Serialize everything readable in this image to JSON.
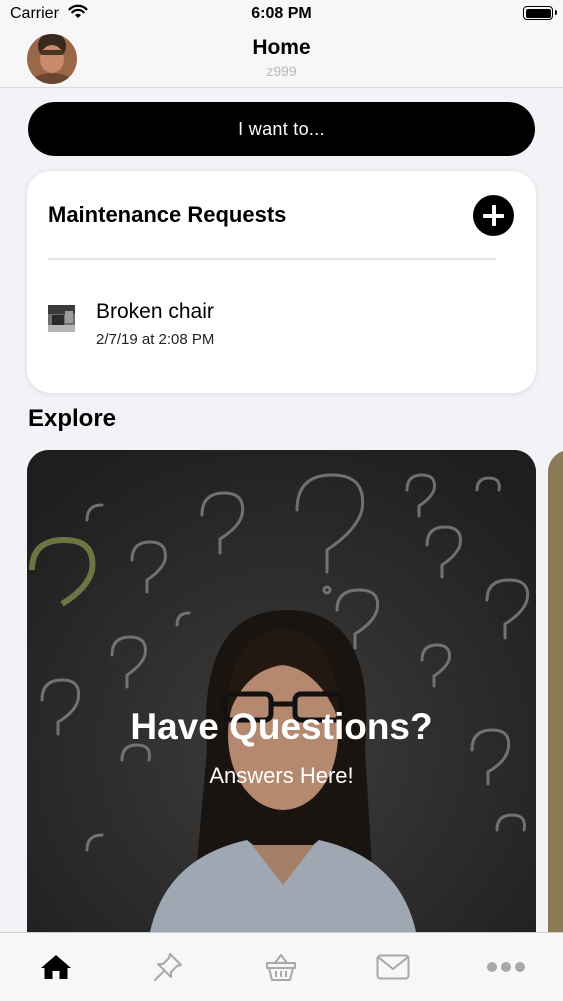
{
  "status_bar": {
    "carrier": "Carrier",
    "time": "6:08 PM"
  },
  "nav": {
    "title": "Home",
    "subtitle": "z999"
  },
  "want_button": {
    "label": "I want to..."
  },
  "maintenance": {
    "title": "Maintenance Requests",
    "requests": [
      {
        "title": "Broken chair",
        "date": "2/7/19 at 2:08 PM"
      }
    ]
  },
  "explore": {
    "heading": "Explore",
    "cards": [
      {
        "title": "Have Questions?",
        "subtitle": "Answers Here!"
      }
    ]
  },
  "tabs": [
    {
      "icon": "home-icon",
      "active": true
    },
    {
      "icon": "pin-icon",
      "active": false
    },
    {
      "icon": "basket-icon",
      "active": false
    },
    {
      "icon": "mail-icon",
      "active": false
    },
    {
      "icon": "more-icon",
      "active": false
    }
  ],
  "colors": {
    "background": "#f2f2f7",
    "accent": "#000000",
    "tab_inactive": "#a8a8ac"
  }
}
